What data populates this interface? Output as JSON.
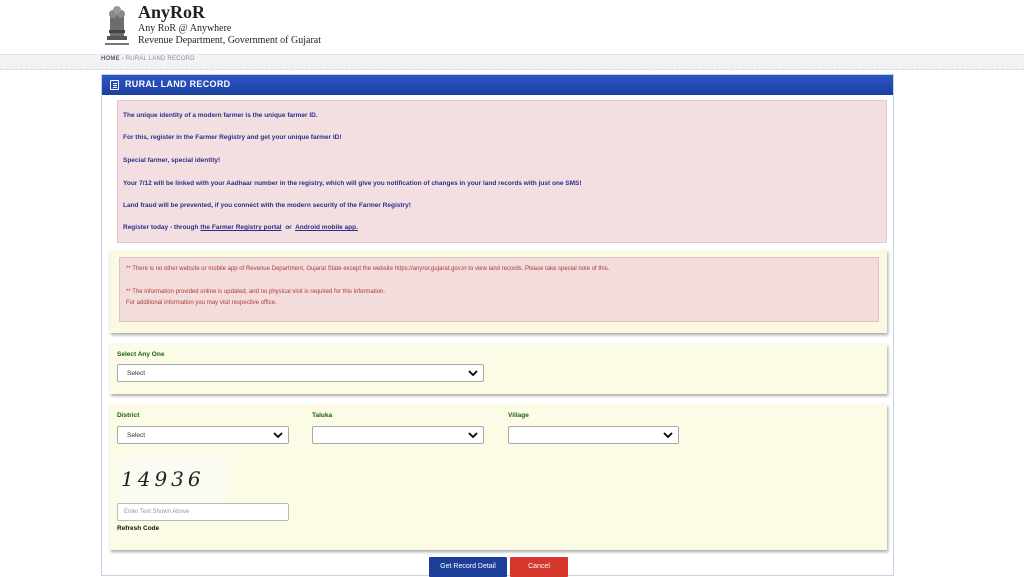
{
  "header": {
    "brand_title": "AnyRoR",
    "brand_sub1": "Any RoR @ Anywhere",
    "brand_sub2": "Revenue Department, Government of Gujarat"
  },
  "breadcrumb": {
    "home": "HOME",
    "separator": "›",
    "current": "RURAL LAND RECORD"
  },
  "panel": {
    "title": "RURAL LAND RECORD",
    "info_lines": [
      "The unique identity of a modern farmer is the unique farmer ID.",
      "For this, register in the Farmer Registry and get your unique farmer ID!",
      "Special farmer, special identity!",
      "Your 7/12 will be linked with your Aadhaar number in the registry, which will give you notification of changes in your land records with just one SMS!",
      "Land fraud will be prevented, if you connect with the modern security of the Farmer Registry!"
    ],
    "register_prefix": "Register today - through",
    "register_link1": "the Farmer Registry portal",
    "register_or": "or",
    "register_link2": "Android mobile app."
  },
  "notice": {
    "line1": "** There is no other website or mobile app of Revenue Department, Gujarat State except the website https://anyror.gujarat.gov.in to view land records. Please take special note of this.",
    "line2": "** The information provided online is updated, and no physical visit is required for this information.",
    "line3": "For additional information you may visit respective office."
  },
  "select_any": {
    "label": "Select Any One",
    "value": "Select"
  },
  "form": {
    "district_label": "District",
    "district_value": "Select",
    "taluka_label": "Taluka",
    "taluka_value": "",
    "village_label": "Village",
    "village_value": "",
    "captcha_text": "14936",
    "captcha_placeholder": "Enter Text Shown Above",
    "refresh_label": "Refresh Code"
  },
  "buttons": {
    "get_record": "Get Record Detail",
    "cancel": "Cancel"
  },
  "colors": {
    "panel_header": "#2446b5",
    "get_button": "#1d3f9a",
    "cancel_button": "#d6372c",
    "label_green": "#1a5e12",
    "notice_red": "#b33a3a"
  }
}
